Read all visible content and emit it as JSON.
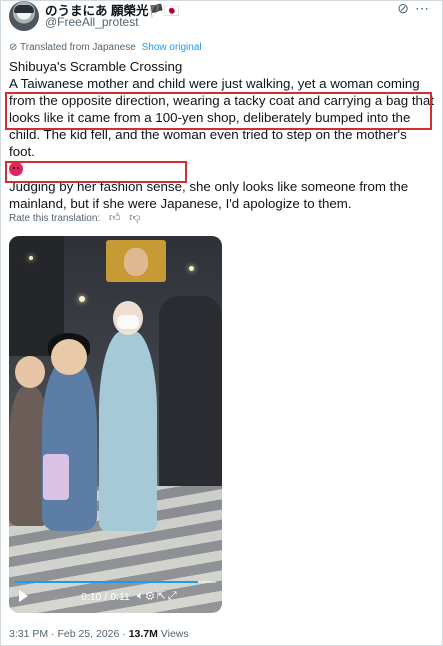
{
  "author": {
    "display_name": "のうまにあ 願榮光🏴🇯🇵",
    "handle": "@FreeAll_protest"
  },
  "header_icons": [
    "grok-icon",
    "more-icon"
  ],
  "translation": {
    "note": "Translated from Japanese",
    "show_original": "Show original"
  },
  "post": {
    "lines": [
      "Shibuya's Scramble Crossing",
      "A Taiwanese mother and child were just walking, yet a woman coming from the opposite direction, wearing a tacky coat and carrying a bag that looks like it came from a 100-yen shop, deliberately bumped into the child. The kid fell, and the woman even tried to step on the mother's foot.",
      "Judging by her fashion sense, she only looks like someone from the mainland, but if she were Japanese, I'd apologize to them."
    ]
  },
  "highlight_color": "#d72b32",
  "rate": {
    "label": "Rate this translation:"
  },
  "video": {
    "time": "0:10 / 0:11",
    "progress": 0.91
  },
  "meta": {
    "time": "3:31 PM",
    "date": "Feb 25, 2026",
    "views": "13.7M",
    "views_label": "Views"
  }
}
